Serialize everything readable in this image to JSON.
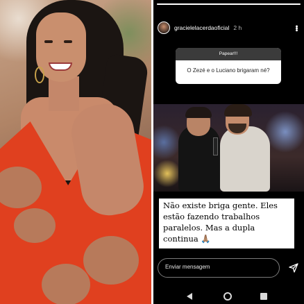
{
  "story": {
    "progress": 1.0,
    "header": {
      "username": "gracielelacerdaoficial",
      "time": "2 h",
      "more_icon": "more-vertical-icon"
    },
    "question_sticker": {
      "title": "Papear!!!",
      "question": "O Zezé e o Luciano brigaram né?"
    },
    "caption": {
      "text": "Não existe briga gente. Eles estão fazendo trabalhos paralelos. Mas a dupla continua 🙏🏽"
    },
    "reply": {
      "placeholder": "Enviar mensagem",
      "send_icon": "send-icon"
    },
    "navigation": {
      "back_icon": "back-icon",
      "home_icon": "home-icon",
      "recent_icon": "recent-apps-icon"
    }
  },
  "colors": {
    "story_background": "#000000",
    "sticker_header": "#3b3b3b",
    "dress_red": "#e0401f"
  }
}
